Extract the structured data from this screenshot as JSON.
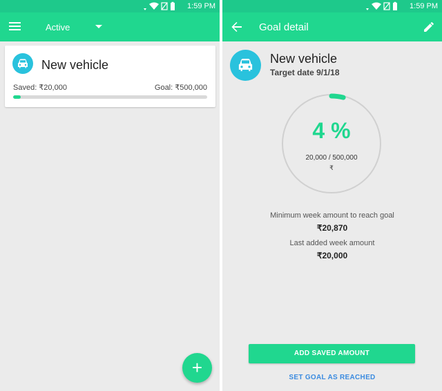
{
  "left_screen": {
    "status": {
      "time": "1:59 PM"
    },
    "toolbar": {
      "filter_label": "Active"
    },
    "goal_card": {
      "title": "New vehicle",
      "saved_label": "Saved: ₹20,000",
      "goal_label": "Goal: ₹500,000",
      "progress_fraction": 0.04
    },
    "fab_label": "+"
  },
  "right_screen": {
    "status": {
      "time": "1:59 PM"
    },
    "toolbar": {
      "title": "Goal detail"
    },
    "goal": {
      "title": "New vehicle",
      "target_date": "Target date 9/1/18",
      "percent_text": "4 %",
      "progress_fraction": 0.04,
      "amount_text": "20,000 / 500,000",
      "currency": "₹",
      "min_week_label": "Minimum week amount to reach goal",
      "min_week_value": "₹20,870",
      "last_week_label": "Last added week amount",
      "last_week_value": "₹20,000"
    },
    "actions": {
      "add_saved_amount": "ADD SAVED AMOUNT",
      "set_goal_reached": "SET GOAL AS REACHED"
    }
  },
  "colors": {
    "primary": "#20d78f",
    "status_bar": "#1ec98b",
    "avatar": "#29c2dd",
    "link": "#3b8be0",
    "background": "#ebebeb"
  },
  "icons": [
    "menu-icon",
    "dropdown-arrow-icon",
    "car-icon",
    "add-icon",
    "back-arrow-icon",
    "edit-pencil-icon",
    "wifi-icon",
    "signal-icon",
    "battery-icon"
  ]
}
